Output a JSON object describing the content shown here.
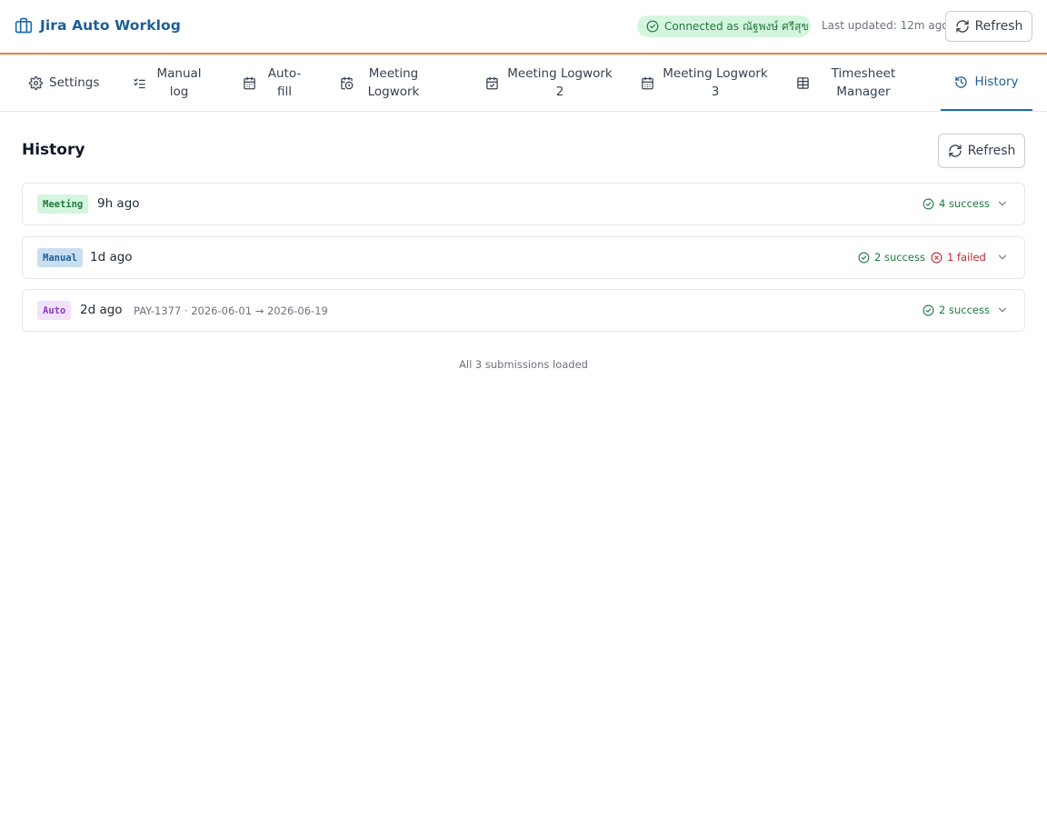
{
  "app": {
    "title": "Jira Auto Worklog",
    "connection": "Connected as ณัฐพงษ์ ศรีสุข",
    "last_updated": "Last updated: 12m ago",
    "refresh_label": "Refresh"
  },
  "tabs": [
    {
      "label": "Settings",
      "icon": "gear-icon"
    },
    {
      "label": "Manual log",
      "icon": "list-check-icon"
    },
    {
      "label": "Auto-fill",
      "icon": "calendar-icon"
    },
    {
      "label": "Meeting Logwork",
      "icon": "calendar-clock-icon"
    },
    {
      "label": "Meeting Logwork 2",
      "icon": "calendar-check-icon"
    },
    {
      "label": "Meeting Logwork 3",
      "icon": "calendar-grid-icon"
    },
    {
      "label": "Timesheet Manager",
      "icon": "table-icon"
    },
    {
      "label": "History",
      "icon": "history-icon",
      "active": true
    }
  ],
  "history": {
    "title": "History",
    "refresh_label": "Refresh",
    "items": [
      {
        "type": "Meeting",
        "ago": "9h ago",
        "meta": "",
        "success": "4 success",
        "failed": ""
      },
      {
        "type": "Manual",
        "ago": "1d ago",
        "meta": "",
        "success": "2 success",
        "failed": "1 failed"
      },
      {
        "type": "Auto",
        "ago": "2d ago",
        "meta": "PAY-1377 · 2026-06-01 → 2026-06-19",
        "success": "2 success",
        "failed": ""
      }
    ],
    "footer": "All 3 submissions loaded"
  },
  "colors": {
    "accent": "#1d5f96",
    "header_border": "#e8813a",
    "success": "#1f7a3d",
    "failed": "#c0262d"
  }
}
